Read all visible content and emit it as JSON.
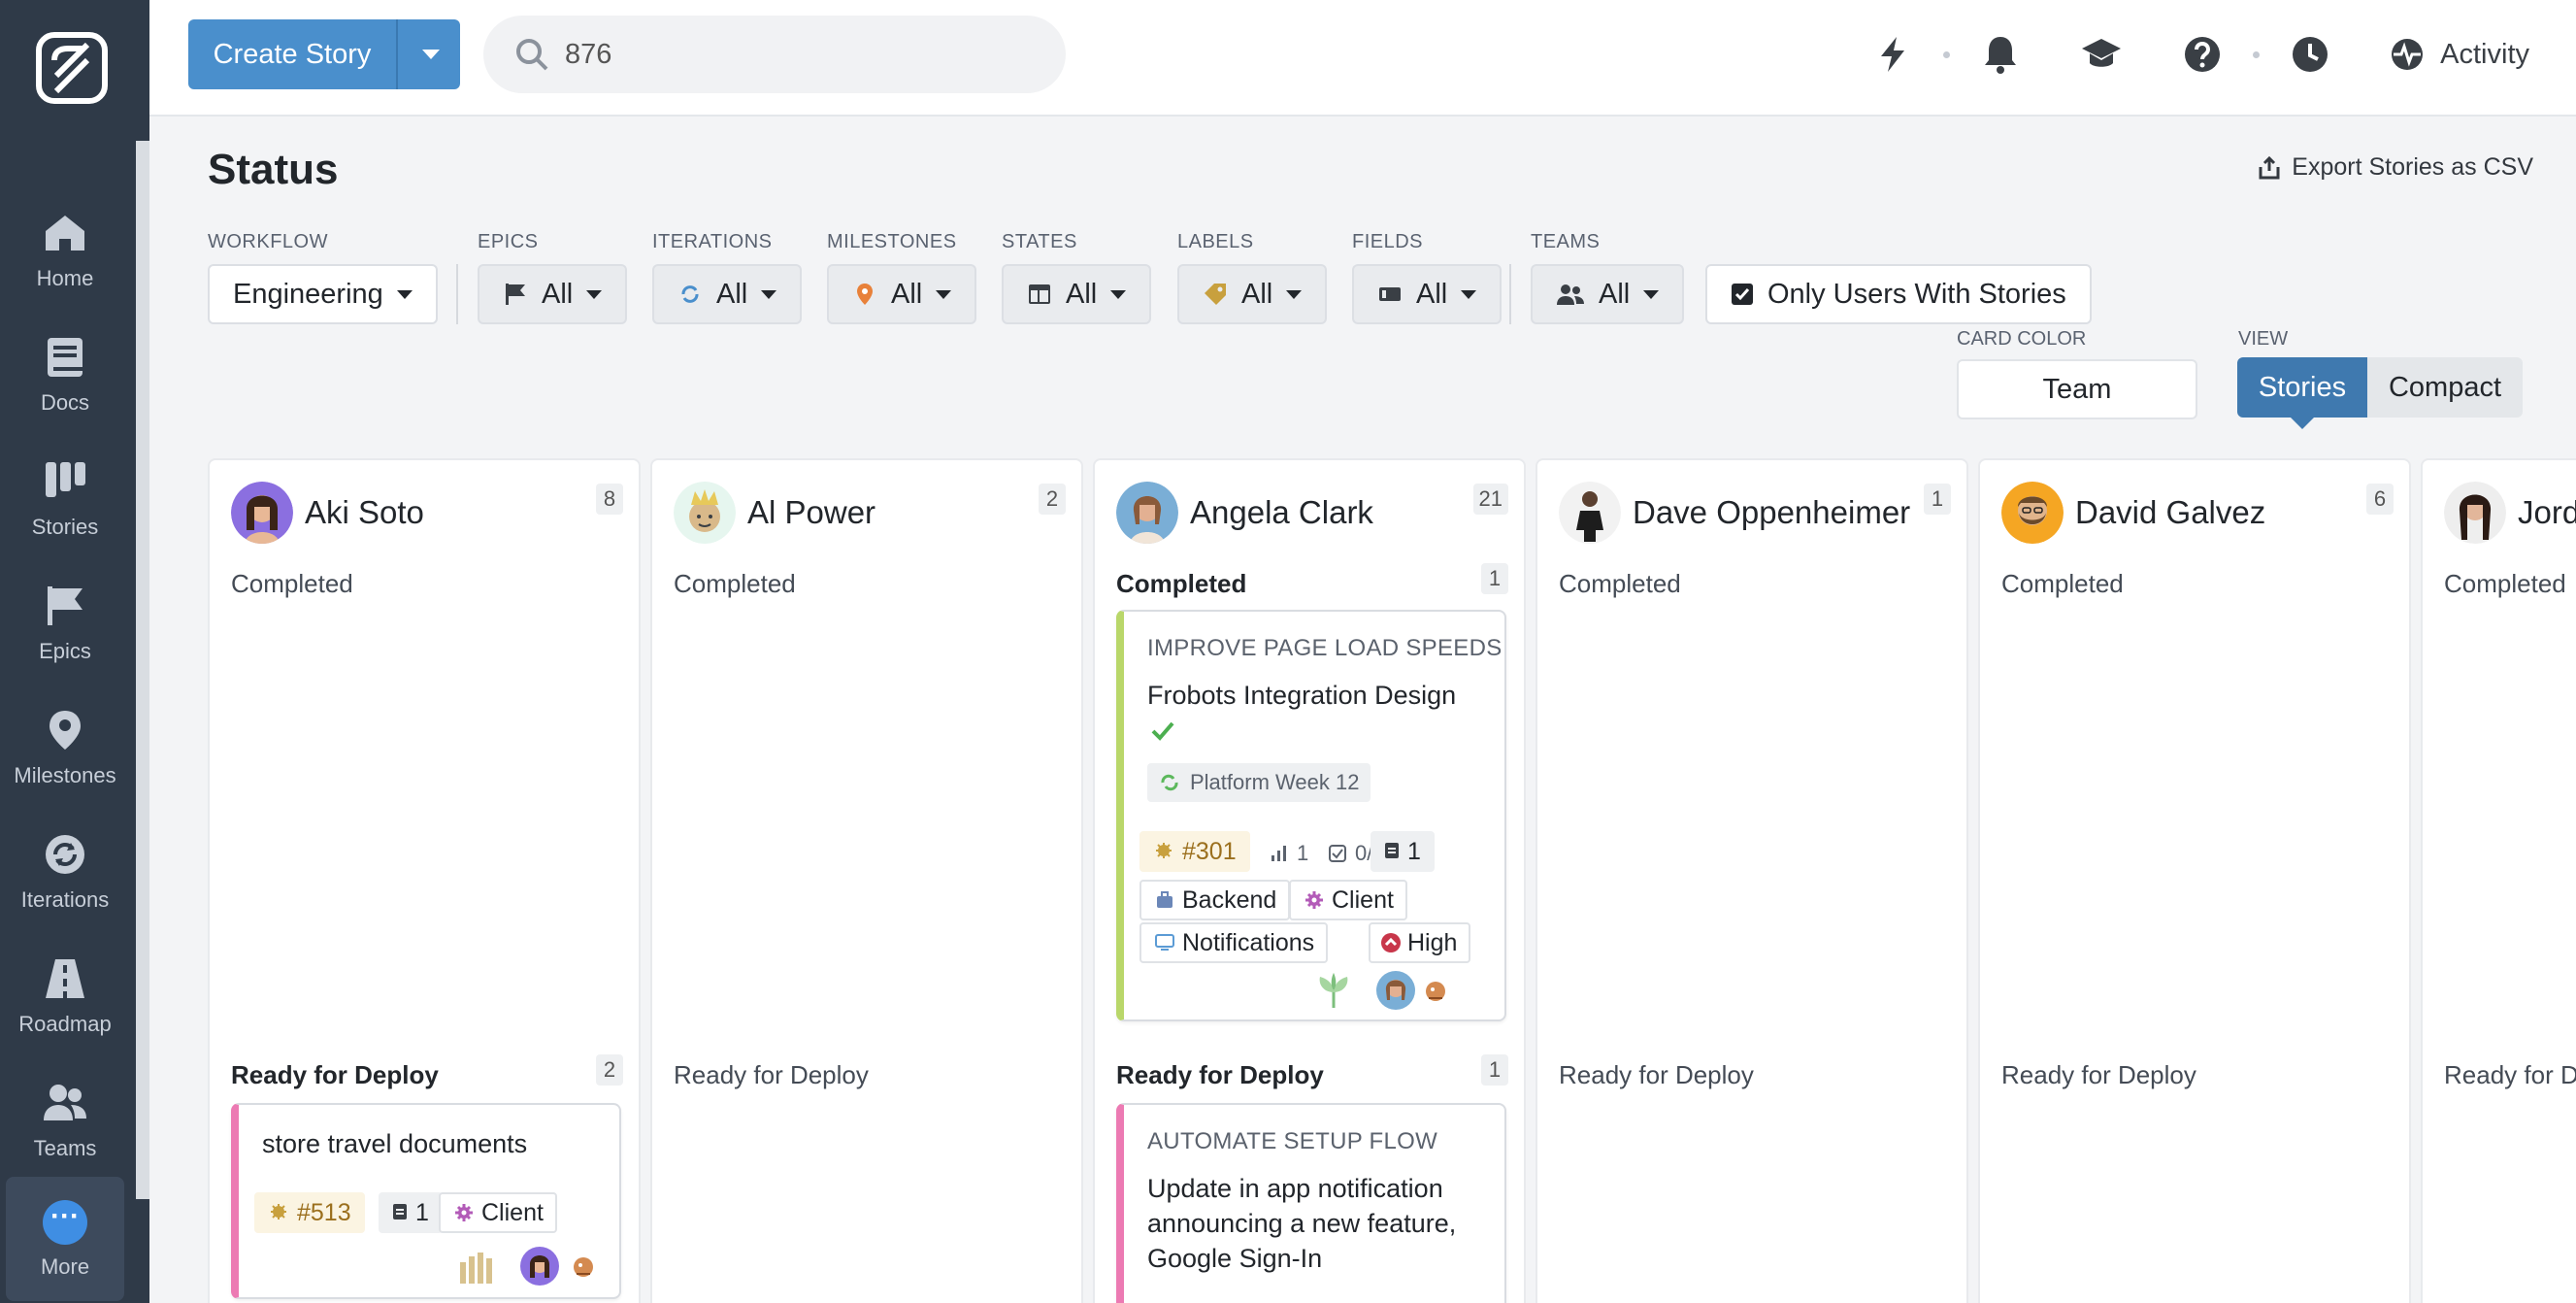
{
  "sidebar": {
    "items": [
      {
        "label": "Home",
        "icon": "home-icon"
      },
      {
        "label": "Docs",
        "icon": "docs-icon"
      },
      {
        "label": "Stories",
        "icon": "stories-icon"
      },
      {
        "label": "Epics",
        "icon": "flag-icon"
      },
      {
        "label": "Milestones",
        "icon": "map-pin-icon"
      },
      {
        "label": "Iterations",
        "icon": "iterations-icon"
      },
      {
        "label": "Roadmap",
        "icon": "roadmap-icon"
      },
      {
        "label": "Teams",
        "icon": "teams-icon"
      },
      {
        "label": "More",
        "icon": "more-icon"
      }
    ]
  },
  "topbar": {
    "create_label": "Create Story",
    "search_value": "876",
    "activity_label": "Activity"
  },
  "page": {
    "title": "Status",
    "export_label": "Export Stories as CSV"
  },
  "filters": {
    "workflow": {
      "label": "WORKFLOW",
      "value": "Engineering"
    },
    "epics": {
      "label": "EPICS",
      "value": "All"
    },
    "iterations": {
      "label": "ITERATIONS",
      "value": "All"
    },
    "milestones": {
      "label": "MILESTONES",
      "value": "All"
    },
    "states": {
      "label": "STATES",
      "value": "All"
    },
    "labels": {
      "label": "LABELS",
      "value": "All"
    },
    "fields": {
      "label": "FIELDS",
      "value": "All"
    },
    "teams": {
      "label": "TEAMS",
      "value": "All"
    },
    "only_users": "Only Users With Stories"
  },
  "card_color": {
    "label": "CARD COLOR",
    "value": "Team"
  },
  "view": {
    "label": "VIEW",
    "options": [
      "Stories",
      "Compact"
    ],
    "selected": "Stories"
  },
  "columns": [
    {
      "name": "Aki Soto",
      "count": "8",
      "completed": "Completed",
      "completed_count": "",
      "ready": "Ready for Deploy",
      "ready_count": "2"
    },
    {
      "name": "Al Power",
      "count": "2",
      "completed": "Completed",
      "completed_count": "",
      "ready": "Ready for Deploy",
      "ready_count": ""
    },
    {
      "name": "Angela Clark",
      "count": "21",
      "completed": "Completed",
      "completed_count": "1",
      "ready": "Ready for Deploy",
      "ready_count": "1"
    },
    {
      "name": "Dave Oppenheimer",
      "count": "1",
      "completed": "Completed",
      "completed_count": "",
      "ready": "Ready for Deploy",
      "ready_count": ""
    },
    {
      "name": "David Galvez",
      "count": "6",
      "completed": "Completed",
      "completed_count": "",
      "ready": "Ready for Deploy",
      "ready_count": ""
    },
    {
      "name": "Jord",
      "count": "",
      "completed": "Completed",
      "completed_count": "",
      "ready": "Ready for D",
      "ready_count": ""
    }
  ],
  "cards": {
    "angela_completed": {
      "epic": "IMPROVE PAGE LOAD SPEEDS",
      "title": "Frobots Integration Design",
      "iteration": "Platform Week 12",
      "id": "#301",
      "estimate": "1",
      "tasks": "0/3",
      "docs": "1",
      "labels": [
        "Backend",
        "Client",
        "Notifications",
        "High"
      ]
    },
    "aki_ready": {
      "title": "store travel documents",
      "id": "#513",
      "docs": "1",
      "label": "Client"
    },
    "angela_ready": {
      "epic": "AUTOMATE SETUP FLOW",
      "title": "Update in app notification announcing a new feature, Google Sign-In"
    }
  },
  "colors": {
    "accent": "#4a8fcc",
    "sidebar": "#2f3a48",
    "epic_green": "#b9d76a",
    "epic_pink": "#ec7ab3"
  }
}
